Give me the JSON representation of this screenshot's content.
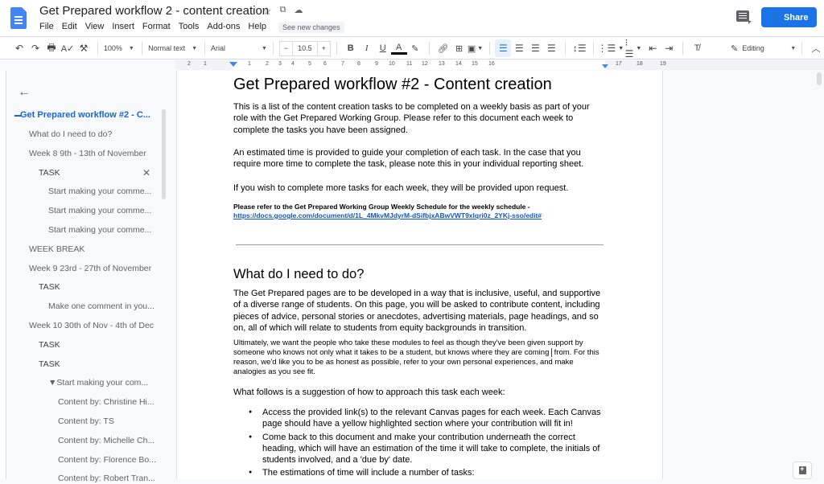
{
  "app": {
    "title": "Get Prepared workflow 2 - content creation",
    "menu": [
      "File",
      "Edit",
      "View",
      "Insert",
      "Format",
      "Tools",
      "Add-ons",
      "Help"
    ],
    "see_new_changes": "See new changes",
    "share_label": "Share"
  },
  "toolbar": {
    "zoom": "100%",
    "style": "Normal text",
    "font": "Arial",
    "font_size": "10.5",
    "minus": "−",
    "plus": "+",
    "mode": "Editing"
  },
  "ruler": {
    "ticks": [
      "2",
      "1",
      "1",
      "2",
      "3",
      "4",
      "5",
      "6",
      "7",
      "8",
      "9",
      "10",
      "11",
      "12",
      "13",
      "14",
      "15",
      "16",
      "17",
      "18",
      "19"
    ]
  },
  "outline": {
    "title": "Get Prepared workflow #2 - C...",
    "items": [
      {
        "label": "What do I need to do?",
        "level": 1
      },
      {
        "label": "Week 8 9th - 13th of November",
        "level": 1
      },
      {
        "label": "TASK",
        "level": 2,
        "selected": true
      },
      {
        "label": "Start making your comme...",
        "level": 3
      },
      {
        "label": "Start making your comme...",
        "level": 3
      },
      {
        "label": "Start making your comme...",
        "level": 3
      },
      {
        "label": "WEEK BREAK",
        "level": 1
      },
      {
        "label": "Week 9 23rd - 27th of November",
        "level": 1
      },
      {
        "label": "TASK",
        "level": 2
      },
      {
        "label": "Make one comment in you...",
        "level": 3
      },
      {
        "label": "Week 10 30th of Nov - 4th of Dec",
        "level": 1
      },
      {
        "label": "TASK",
        "level": 2
      },
      {
        "label": "TASK",
        "level": 2
      },
      {
        "label": "▼Start making your com...",
        "level": 3
      },
      {
        "label": "Content by: Christine Hi...",
        "level": 4
      },
      {
        "label": "Content by: TS",
        "level": 4
      },
      {
        "label": "Content by: Michelle Ch...",
        "level": 4
      },
      {
        "label": "Content by: Florence Bo...",
        "level": 4
      },
      {
        "label": "Content by: Robert Tran...",
        "level": 4
      }
    ]
  },
  "document": {
    "heading": "Get Prepared workflow #2 - Content creation",
    "intro": "This is a list of the content creation tasks to be completed on a weekly basis as part of your role with the Get Prepared Working Group. Please refer to this document each week to complete the tasks you have been assigned.",
    "estimate": "An estimated time is provided to guide your completion of each task. In the case that you require more time to complete the task, please note this in your individual reporting sheet.",
    "more_tasks": "If you wish to complete more tasks for each week, they will be provided upon request.",
    "schedule_note": "Please refer to the Get Prepared Working Group Weekly Schedule for the weekly schedule -",
    "schedule_link": "https://docs.google.com/document/d/1L_4MkvMJdyrM-dSifbjxABwVWT9xlqri0z_2YKj-sso/edit#",
    "section_heading": "What do I need to do?",
    "section_p1": "The Get Prepared pages are to be developed in a way that is inclusive, useful, and supportive of a diverse range of students. On this page, you will be asked to contribute content, including pieces of advice, personal stories or anecdotes, advertising materials, page headings, and so on, all of which will relate to students from equity backgrounds in transition.",
    "section_p2a": "Ultimately, we want the people who take these modules to feel as though they've been given support by someone who knows not only what it takes to be a student, but knows where they are coming",
    "section_p2b": "from. For this reason, we'd like you to be as honest as possible, refer to your own personal experiences, and make analogies as you see fit.",
    "section_p3": "What follows is a suggestion of how to approach this task each week:",
    "bullets": [
      "Access the provided link(s) to the relevant Canvas pages for each week. Each Canvas page should have a yellow highlighted section where your contribution will fit in!",
      "Come back to this document and make your contribution underneath the correct heading, which will have an estimation of the time it will take to complete, the initials of students involved, and a 'due by' date.",
      "The estimations of time will include a number of tasks:"
    ]
  }
}
